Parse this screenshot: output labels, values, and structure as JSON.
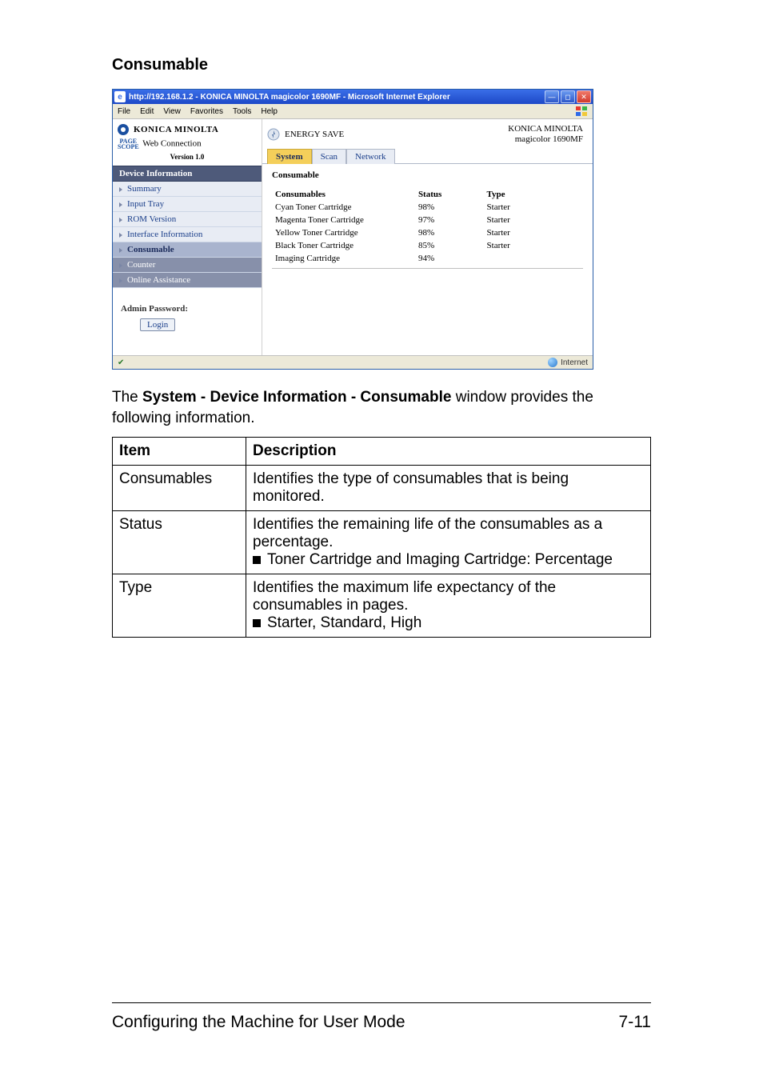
{
  "section_heading": "Consumable",
  "ie": {
    "title": "http://192.168.1.2 - KONICA MINOLTA magicolor 1690MF - Microsoft Internet Explorer",
    "menu": [
      "File",
      "Edit",
      "View",
      "Favorites",
      "Tools",
      "Help"
    ],
    "status_right": "Internet"
  },
  "sidebar": {
    "brand": "KONICA MINOLTA",
    "pagescope_prefix": "PAGE\nSCOPE",
    "pagescope": "Web Connection",
    "version": "Version 1.0",
    "group_header": "Device Information",
    "items": [
      {
        "label": "Summary",
        "sel": false,
        "dark": false
      },
      {
        "label": "Input Tray",
        "sel": false,
        "dark": false
      },
      {
        "label": "ROM Version",
        "sel": false,
        "dark": false
      },
      {
        "label": "Interface Information",
        "sel": false,
        "dark": false
      },
      {
        "label": "Consumable",
        "sel": true,
        "dark": false
      },
      {
        "label": "Counter",
        "sel": false,
        "dark": true
      },
      {
        "label": "Online Assistance",
        "sel": false,
        "dark": true
      }
    ],
    "admin_pw_label": "Admin Password:",
    "login": "Login"
  },
  "main": {
    "energy_label": "ENERGY SAVE",
    "device_line1": "KONICA MINOLTA",
    "device_line2": "magicolor 1690MF",
    "tabs": [
      {
        "label": "System",
        "active": true
      },
      {
        "label": "Scan",
        "active": false
      },
      {
        "label": "Network",
        "active": false
      }
    ],
    "panel_title": "Consumable",
    "columns": {
      "c1": "Consumables",
      "c2": "Status",
      "c3": "Type"
    },
    "rows": [
      {
        "name": "Cyan Toner Cartridge",
        "status": "98%",
        "type": "Starter"
      },
      {
        "name": "Magenta Toner Cartridge",
        "status": "97%",
        "type": "Starter"
      },
      {
        "name": "Yellow Toner Cartridge",
        "status": "98%",
        "type": "Starter"
      },
      {
        "name": "Black Toner Cartridge",
        "status": "85%",
        "type": "Starter"
      },
      {
        "name": "Imaging Cartridge",
        "status": "94%",
        "type": ""
      }
    ]
  },
  "bodytext": {
    "pre": "The ",
    "bold": "System - Device Information - Consumable",
    "post": " window provides the following information."
  },
  "doc_table": {
    "head": {
      "item": "Item",
      "desc": "Description"
    },
    "rows": [
      {
        "item": "Consumables",
        "desc": "Identifies the type of consumables that is being monitored."
      },
      {
        "item": "Status",
        "desc": "Identifies the remaining life of the consumables as a percentage.",
        "bullets": [
          "Toner Cartridge and Imaging Cartridge: Percentage"
        ]
      },
      {
        "item": "Type",
        "desc": "Identifies the maximum life expectancy of the consumables in pages.",
        "bullets": [
          "Starter, Standard, High"
        ]
      }
    ]
  },
  "footer": {
    "left": "Configuring the Machine for User Mode",
    "right": "7-11"
  }
}
